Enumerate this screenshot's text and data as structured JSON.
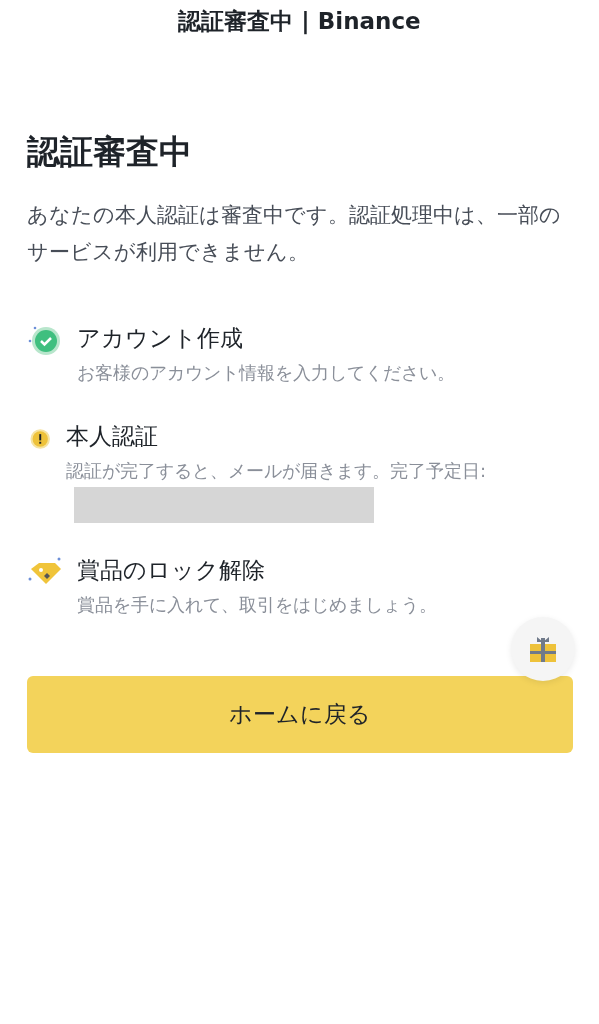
{
  "window": {
    "title": "認証審査中 | Binance"
  },
  "heading": "認証審査中",
  "description": "あなたの本人認証は審査中です。認証処理中は、一部のサービスが利用できません。",
  "steps": [
    {
      "kind": "done",
      "title": "アカウント作成",
      "detail": "お客様のアカウント情報を入力してください。"
    },
    {
      "kind": "pending",
      "title": "本人認証",
      "detail": "認証が完了すると、メールが届きます。完了予定日:",
      "redacted": true
    },
    {
      "kind": "reward",
      "title": "賞品のロック解除",
      "detail": "賞品を手に入れて、取引をはじめましょう。"
    }
  ],
  "primary_button": "ホームに戻る"
}
